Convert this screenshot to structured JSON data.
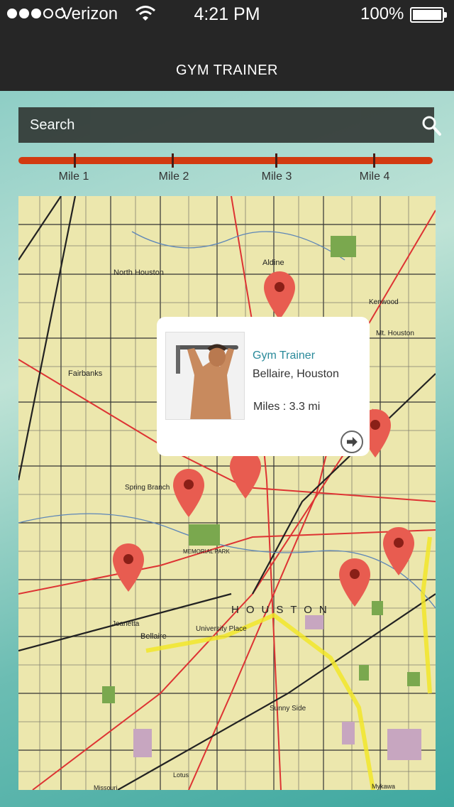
{
  "status_bar": {
    "carrier": "Verizon",
    "time": "4:21 PM",
    "battery": "100%"
  },
  "header": {
    "title": "GYM TRAINER"
  },
  "search": {
    "placeholder": "Search"
  },
  "distance": {
    "labels": [
      "Mile 1",
      "Mile 2",
      "Mile 3",
      "Mile 4"
    ]
  },
  "map": {
    "labels": {
      "aldine": "Aldine",
      "north_houston": "North Houston",
      "fairbanks": "Fairbanks",
      "spring_branch": "Spring Branch",
      "jeanetta": "Jeanetta",
      "bellaire": "Bellaire",
      "university_place": "University Place",
      "sunny_side": "Sunny Side",
      "houston": "HOUSTON",
      "kenwood": "Kenwood",
      "mt_houston": "Mt. Houston",
      "memorial_park": "MEMORIAL PARK",
      "missouri": "Missouri",
      "mykawa": "Mykawa",
      "lotus": "Lotus"
    }
  },
  "popup": {
    "name": "Gym Trainer",
    "location": "Bellaire, Houston",
    "miles": "Miles : 3.3 mi"
  },
  "colors": {
    "pin": "#e74c3c",
    "slider": "#d23a10",
    "header": "#262626"
  }
}
